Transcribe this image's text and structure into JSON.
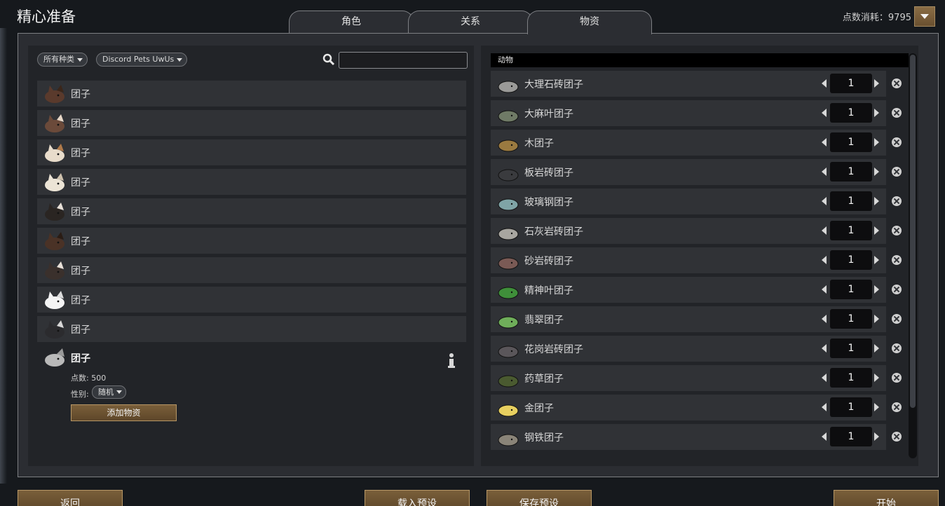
{
  "title": "精心准备",
  "tabs": [
    {
      "label": "角色"
    },
    {
      "label": "关系"
    },
    {
      "label": "物资"
    }
  ],
  "points": {
    "label": "点数消耗：9795"
  },
  "filters": {
    "category": "所有种类",
    "source": "Discord Pets UwUs"
  },
  "search": {
    "placeholder": ""
  },
  "pets": [
    {
      "name": "团子"
    },
    {
      "name": "团子"
    },
    {
      "name": "团子"
    },
    {
      "name": "团子"
    },
    {
      "name": "团子"
    },
    {
      "name": "团子"
    },
    {
      "name": "团子"
    },
    {
      "name": "团子"
    },
    {
      "name": "团子"
    }
  ],
  "selected": {
    "name": "团子",
    "points": "点数: 500",
    "gender_label": "性别:",
    "gender_value": "随机",
    "add_button": "添加物资"
  },
  "category": "动物",
  "items": [
    {
      "name": "大理石砖团子",
      "qty": "1"
    },
    {
      "name": "大麻叶团子",
      "qty": "1"
    },
    {
      "name": "木团子",
      "qty": "1"
    },
    {
      "name": "板岩砖团子",
      "qty": "1"
    },
    {
      "name": "玻璃钢团子",
      "qty": "1"
    },
    {
      "name": "石灰岩砖团子",
      "qty": "1"
    },
    {
      "name": "砂岩砖团子",
      "qty": "1"
    },
    {
      "name": "精神叶团子",
      "qty": "1"
    },
    {
      "name": "翡翠团子",
      "qty": "1"
    },
    {
      "name": "花岗岩砖团子",
      "qty": "1"
    },
    {
      "name": "药草团子",
      "qty": "1"
    },
    {
      "name": "金团子",
      "qty": "1"
    },
    {
      "name": "钢铁团子",
      "qty": "1"
    }
  ],
  "bottom": {
    "back": "返回",
    "load": "载入预设",
    "save": "保存预设",
    "start": "开始"
  },
  "colors": {
    "accent": "#7a5f3a",
    "panel": "#2b2d32",
    "row": "#303236"
  }
}
